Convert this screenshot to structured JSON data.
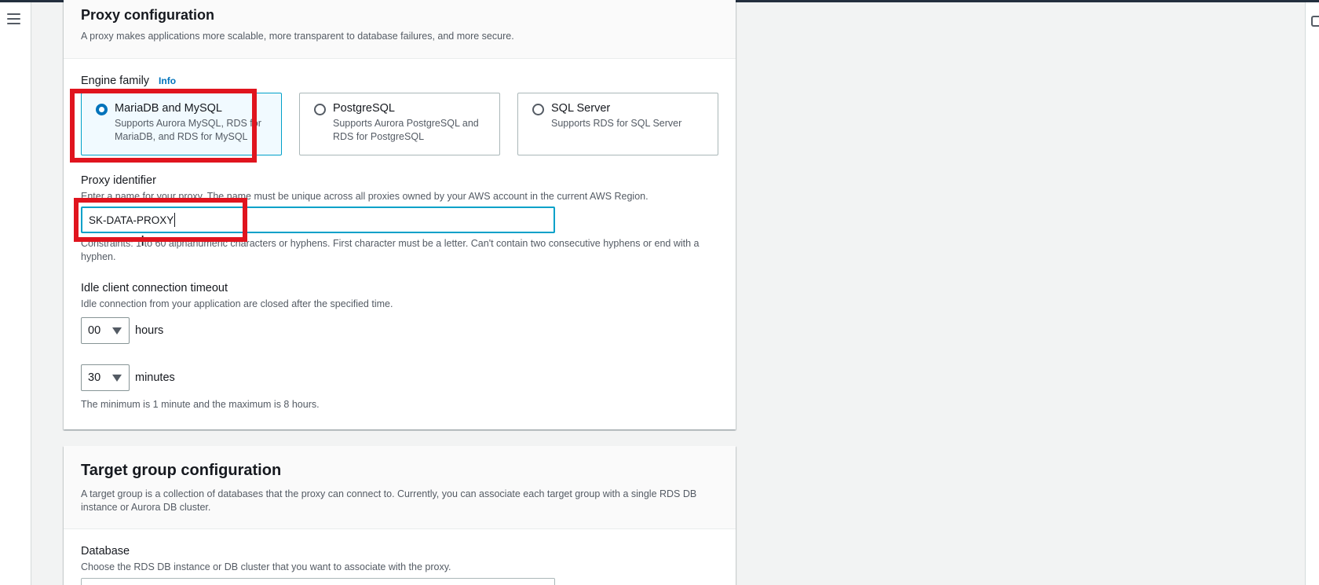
{
  "proxy_config": {
    "title": "Proxy configuration",
    "description": "A proxy makes applications more scalable, more transparent to database failures, and more secure.",
    "engine_family": {
      "label": "Engine family",
      "info": "Info",
      "options": [
        {
          "title": "MariaDB and MySQL",
          "description": "Supports Aurora MySQL, RDS for MariaDB, and RDS for MySQL",
          "selected": true
        },
        {
          "title": "PostgreSQL",
          "description": "Supports Aurora PostgreSQL and RDS for PostgreSQL",
          "selected": false
        },
        {
          "title": "SQL Server",
          "description": "Supports RDS for SQL Server",
          "selected": false
        }
      ]
    },
    "proxy_identifier": {
      "label": "Proxy identifier",
      "description": "Enter a name for your proxy. The name must be unique across all proxies owned by your AWS account in the current AWS Region.",
      "value": "SK-DATA-PROXY",
      "constraints": "Constraints: 1 to 60 alphanumeric characters or hyphens. First character must be a letter. Can't contain two consecutive hyphens or end with a hyphen."
    },
    "idle_timeout": {
      "label": "Idle client connection timeout",
      "description": "Idle connection from your application are closed after the specified time.",
      "hours_value": "00",
      "hours_unit": "hours",
      "minutes_value": "30",
      "minutes_unit": "minutes",
      "hint": "The minimum is 1 minute and the maximum is 8 hours."
    }
  },
  "target_group": {
    "title": "Target group configuration",
    "description": "A target group is a collection of databases that the proxy can connect to. Currently, you can associate each target group with a single RDS DB instance or Aurora DB cluster.",
    "database": {
      "label": "Database",
      "description": "Choose the RDS DB instance or DB cluster that you want to associate with the proxy."
    }
  },
  "colors": {
    "highlight": "#e0141e",
    "accent": "#0073bb",
    "selected_border": "#00a1c9"
  }
}
